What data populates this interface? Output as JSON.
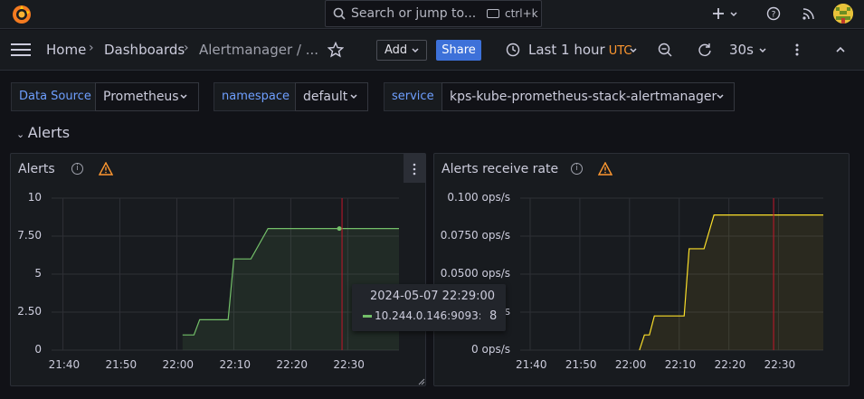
{
  "topbar": {
    "search_placeholder": "Search or jump to...",
    "search_shortcut": "ctrl+k",
    "icons": [
      "grafana-logo-icon",
      "search-icon",
      "keyboard-icon",
      "plus-icon",
      "chevron-down-icon",
      "help-icon",
      "rss-icon",
      "user-avatar"
    ]
  },
  "navbar": {
    "breadcrumb": [
      "Home",
      "Dashboards",
      "Alertmanager / ..."
    ],
    "add_label": "Add",
    "share_label": "Share",
    "time_range": "Last 1 hour",
    "timezone": "UTC",
    "refresh_interval": "30s"
  },
  "variables": [
    {
      "label": "Data Source",
      "value": "Prometheus"
    },
    {
      "label": "namespace",
      "value": "default"
    },
    {
      "label": "service",
      "value": "kps-kube-prometheus-stack-alertmanager"
    }
  ],
  "row": {
    "title": "Alerts"
  },
  "colors": {
    "green_series": "#73bf69",
    "yellow_series": "#fade2a",
    "now_marker": "#c4162a",
    "accent_blue": "#3d71d9",
    "warning": "#ff9830"
  },
  "panels": [
    {
      "title": "Alerts"
    },
    {
      "title": "Alerts receive rate"
    }
  ],
  "tooltip": {
    "time": "2024-05-07 22:29:00",
    "series": "10.244.0.146:9093:",
    "value": "8"
  },
  "chart_data": [
    {
      "type": "line",
      "title": "Alerts",
      "x_ticks": [
        "21:40",
        "21:50",
        "22:00",
        "22:10",
        "22:20",
        "22:30"
      ],
      "y_ticks": [
        "0",
        "2.50",
        "5",
        "7.50",
        "10"
      ],
      "ylim": [
        0,
        10
      ],
      "xlim": [
        "21:38",
        "22:39"
      ],
      "grid": true,
      "series": [
        {
          "points": [
            [
              "22:01",
              1
            ],
            [
              "22:03",
              1
            ],
            [
              "22:04",
              2
            ],
            [
              "22:09",
              2
            ],
            [
              "22:10",
              6
            ],
            [
              "22:13",
              6
            ],
            [
              "22:16",
              8
            ],
            [
              "22:39",
              8
            ]
          ]
        }
      ],
      "annotation_time": "22:29"
    },
    {
      "type": "line",
      "title": "Alerts receive rate",
      "x_ticks": [
        "21:40",
        "21:50",
        "22:00",
        "22:10",
        "22:20",
        "22:30"
      ],
      "y_ticks": [
        "0 ops/s",
        "0.0250 ops/s",
        "0.0500 ops/s",
        "0.0750 ops/s",
        "0.100 ops/s"
      ],
      "ylim": [
        0,
        0.1
      ],
      "xlim": [
        "21:38",
        "22:39"
      ],
      "grid": true,
      "series": [
        {
          "points": [
            [
              "22:02",
              0
            ],
            [
              "22:03",
              0.01
            ],
            [
              "22:04",
              0.01
            ],
            [
              "22:05",
              0.0225
            ],
            [
              "22:11",
              0.0225
            ],
            [
              "22:12",
              0.0667
            ],
            [
              "22:15",
              0.0667
            ],
            [
              "22:17",
              0.0889
            ],
            [
              "22:39",
              0.0889
            ]
          ]
        }
      ],
      "annotation_time": "22:29"
    }
  ]
}
